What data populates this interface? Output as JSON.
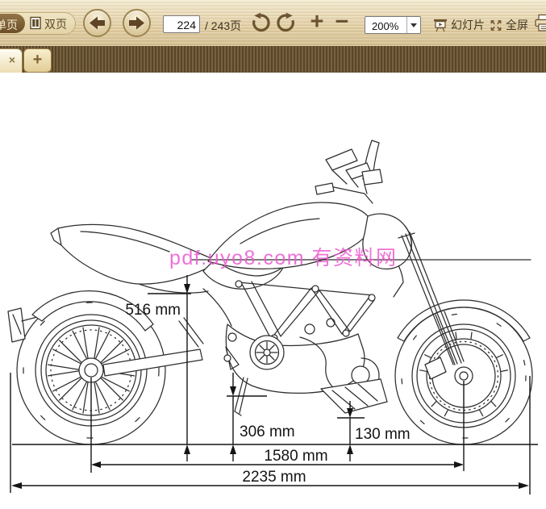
{
  "toolbar": {
    "single_page": "单页",
    "double_page": "双页",
    "page_current": "224",
    "page_total": "/ 243页",
    "zoom_in": "+",
    "zoom_out": "−",
    "zoom_level": "200%",
    "slideshow": "幻灯片",
    "fullscreen": "全屏"
  },
  "tabbar": {
    "close": "×",
    "new_tab": "+"
  },
  "drawing": {
    "watermark": "pdf.uyo8.com 有资料网",
    "dimensions": {
      "seat_height": "516 mm",
      "mid_height": "306 mm",
      "ground_clearance": "130 mm",
      "wheelbase": "1580 mm",
      "overall_length": "2235 mm"
    }
  },
  "colors": {
    "toolbar_tan": "#e0cda2",
    "tabbar_brown": "#6f5733",
    "accent_brown": "#6b5330",
    "watermark_pink": "#ee58cf",
    "line_black": "#141414"
  }
}
